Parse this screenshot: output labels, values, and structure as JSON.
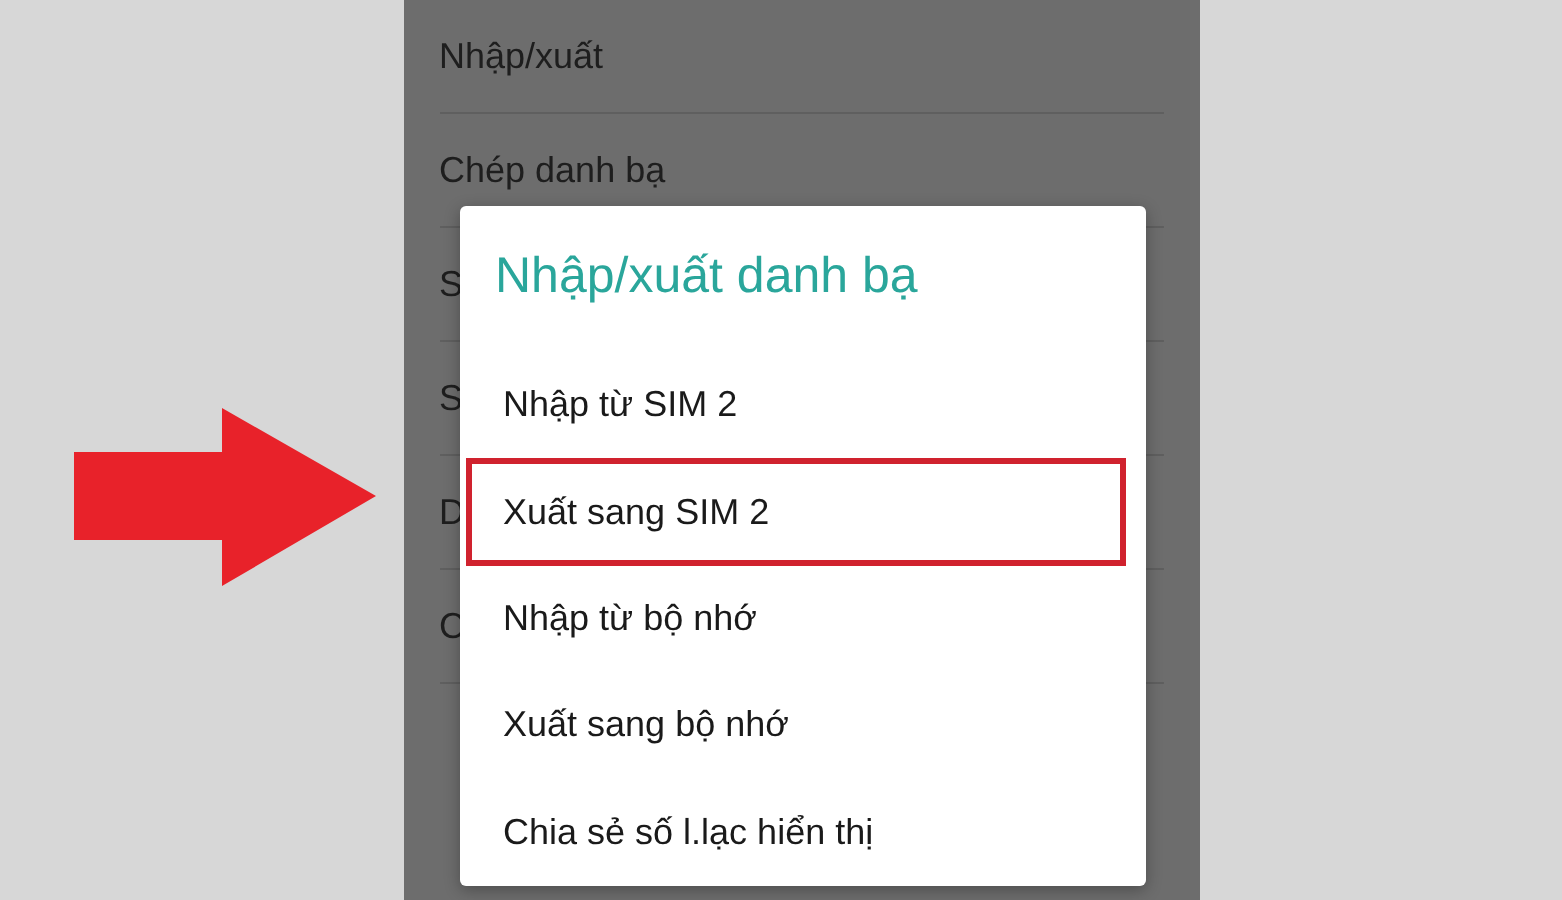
{
  "background_list": {
    "items": [
      {
        "label": "Nhập/xuất"
      },
      {
        "label": "Chép danh bạ"
      },
      {
        "label": "S"
      },
      {
        "label": "S"
      },
      {
        "label": "D"
      },
      {
        "label": "C"
      }
    ]
  },
  "dialog": {
    "title": "Nhập/xuất danh bạ",
    "items": [
      {
        "label": "Nhập từ SIM 2",
        "highlighted": false
      },
      {
        "label": "Xuất sang SIM 2",
        "highlighted": true
      },
      {
        "label": "Nhập từ bộ nhớ",
        "highlighted": false
      },
      {
        "label": "Xuất sang bộ nhớ",
        "highlighted": false
      },
      {
        "label": "Chia sẻ số l.lạc hiển thị",
        "highlighted": false
      }
    ]
  },
  "annotation": {
    "kind": "arrow"
  }
}
